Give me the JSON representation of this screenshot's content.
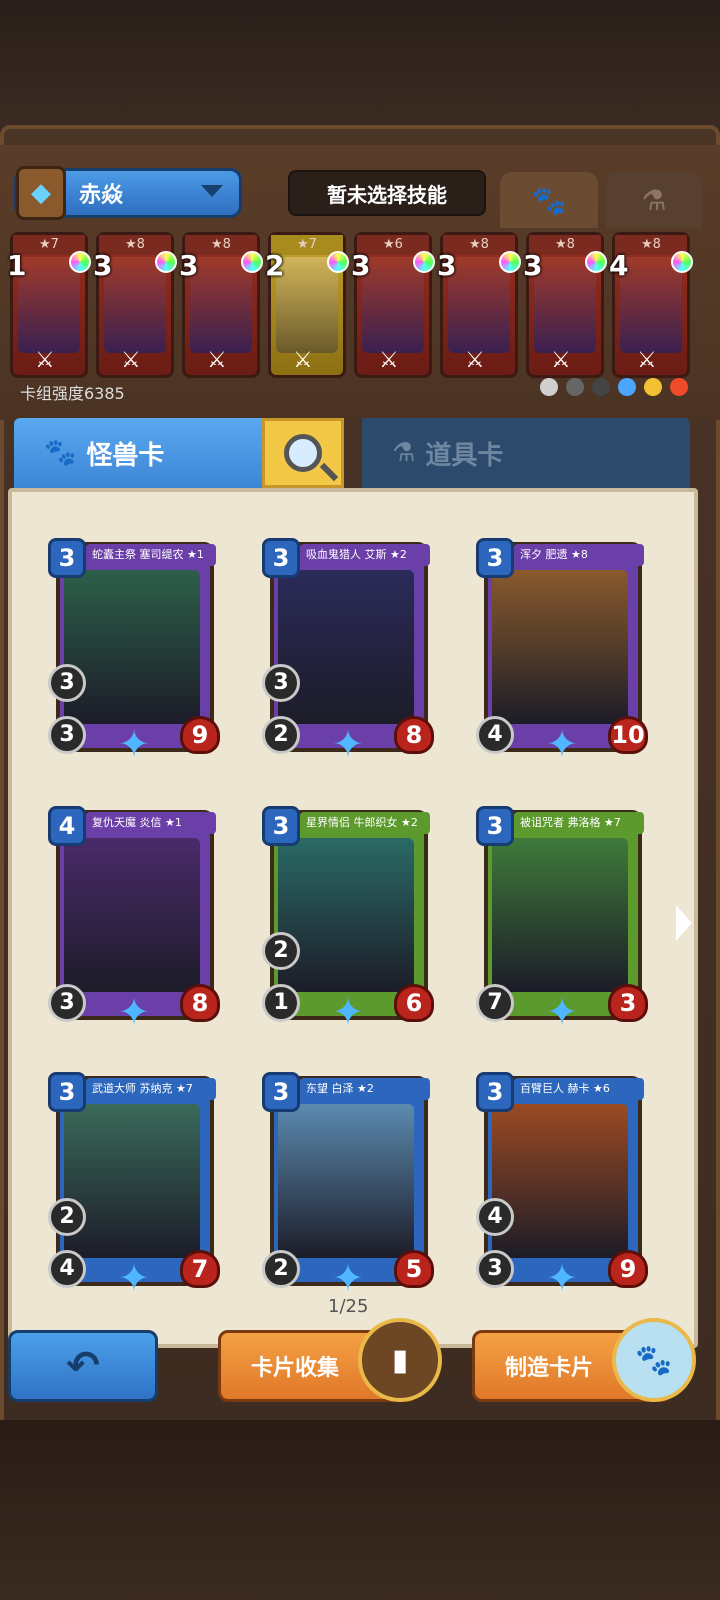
{
  "deck": {
    "name": "赤焱",
    "skill_placeholder": "暂未选择技能",
    "power_label": "卡组强度6385",
    "cards": [
      {
        "cost": "1",
        "stars": "★7",
        "color": "red"
      },
      {
        "cost": "3",
        "stars": "★8",
        "color": "red"
      },
      {
        "cost": "3",
        "stars": "★8",
        "color": "red"
      },
      {
        "cost": "2",
        "stars": "★7",
        "color": "yellow"
      },
      {
        "cost": "3",
        "stars": "★6",
        "color": "red"
      },
      {
        "cost": "3",
        "stars": "★8",
        "color": "red"
      },
      {
        "cost": "3",
        "stars": "★8",
        "color": "red"
      },
      {
        "cost": "4",
        "stars": "★8",
        "color": "red"
      }
    ]
  },
  "tabs": {
    "monster": "怪兽卡",
    "item": "道具卡"
  },
  "collection": {
    "page": "1/25",
    "cards": [
      {
        "name": "蛇蠹主祭 塞司缇农 ★1",
        "cost": "3",
        "atk": "3",
        "hp": "9",
        "mid": "3",
        "frame": "#6b3fa8",
        "art": "#2c5f49"
      },
      {
        "name": "吸血鬼猎人 艾斯 ★2",
        "cost": "3",
        "atk": "2",
        "hp": "8",
        "mid": "3",
        "frame": "#6b3fa8",
        "art": "#2b2a5a"
      },
      {
        "name": "浑夕 肥遗 ★8",
        "cost": "3",
        "atk": "4",
        "hp": "10",
        "mid": "",
        "frame": "#6b3fa8",
        "art": "#8a5a2c"
      },
      {
        "name": "复仇天魔 炎信 ★1",
        "cost": "4",
        "atk": "3",
        "hp": "8",
        "mid": "",
        "frame": "#6b3fa8",
        "art": "#4a2a6a"
      },
      {
        "name": "星界情侣 牛郎织女 ★2",
        "cost": "3",
        "atk": "1",
        "hp": "6",
        "mid": "2",
        "frame": "#5c9a2e",
        "art": "#2a6a66"
      },
      {
        "name": "被诅咒者 弗洛格 ★7",
        "cost": "3",
        "atk": "7",
        "hp": "3",
        "mid": "",
        "frame": "#5c9a2e",
        "art": "#3f7a3a"
      },
      {
        "name": "武道大师 苏纳克 ★7",
        "cost": "3",
        "atk": "4",
        "hp": "7",
        "mid": "2",
        "frame": "#2d67bd",
        "art": "#3a6a5a"
      },
      {
        "name": "东望 白泽 ★2",
        "cost": "3",
        "atk": "2",
        "hp": "5",
        "mid": "",
        "frame": "#2d67bd",
        "art": "#5b8ab0"
      },
      {
        "name": "百臂巨人 赫卡 ★6",
        "cost": "3",
        "atk": "3",
        "hp": "9",
        "mid": "4",
        "frame": "#2d67bd",
        "art": "#9b4a22"
      }
    ]
  },
  "buttons": {
    "collect": "卡片收集",
    "craft": "制造卡片"
  },
  "icons": [
    "paw-icon",
    "potion-icon",
    "search-icon",
    "back-arrow-icon",
    "next-page-icon",
    "star-icon"
  ]
}
